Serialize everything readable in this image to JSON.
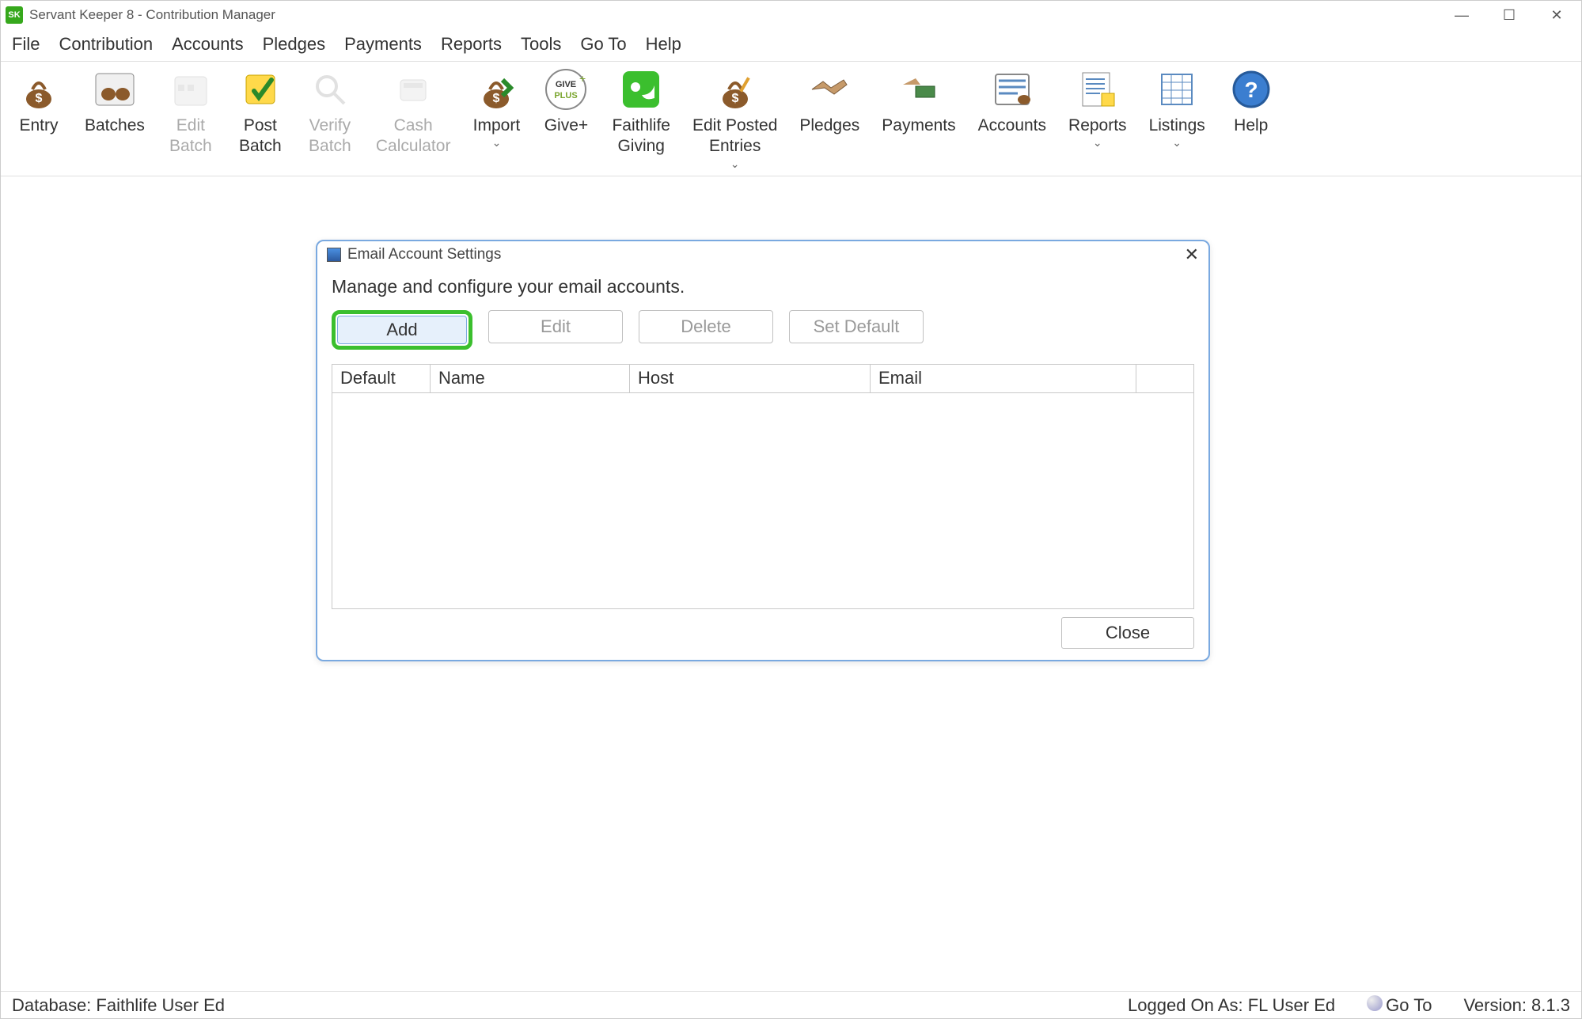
{
  "title": "Servant Keeper 8 - Contribution Manager",
  "menu": [
    "File",
    "Contribution",
    "Accounts",
    "Pledges",
    "Payments",
    "Reports",
    "Tools",
    "Go To",
    "Help"
  ],
  "toolbar": [
    {
      "label": "Entry",
      "icon": "bag",
      "disabled": false,
      "drop": false
    },
    {
      "label": "Batches",
      "icon": "batches",
      "disabled": false,
      "drop": false
    },
    {
      "label": "Edit\nBatch",
      "icon": "calendar",
      "disabled": true,
      "drop": false
    },
    {
      "label": "Post\nBatch",
      "icon": "post",
      "disabled": false,
      "drop": false
    },
    {
      "label": "Verify\nBatch",
      "icon": "verify",
      "disabled": true,
      "drop": false
    },
    {
      "label": "Cash\nCalculator",
      "icon": "calc",
      "disabled": true,
      "drop": false
    },
    {
      "label": "Import",
      "icon": "import",
      "disabled": false,
      "drop": true
    },
    {
      "label": "Give+",
      "icon": "giveplus",
      "disabled": false,
      "drop": false
    },
    {
      "label": "Faithlife\nGiving",
      "icon": "faithlife",
      "disabled": false,
      "drop": false
    },
    {
      "label": "Edit Posted\nEntries",
      "icon": "editposted",
      "disabled": false,
      "drop": true
    },
    {
      "label": "Pledges",
      "icon": "pledges",
      "disabled": false,
      "drop": false
    },
    {
      "label": "Payments",
      "icon": "payments",
      "disabled": false,
      "drop": false
    },
    {
      "label": "Accounts",
      "icon": "accounts",
      "disabled": false,
      "drop": false
    },
    {
      "label": "Reports",
      "icon": "reports",
      "disabled": false,
      "drop": true
    },
    {
      "label": "Listings",
      "icon": "listings",
      "disabled": false,
      "drop": true
    },
    {
      "label": "Help",
      "icon": "help",
      "disabled": false,
      "drop": false
    }
  ],
  "dialog": {
    "title": "Email Account Settings",
    "description": "Manage and configure your email accounts.",
    "buttons": {
      "add": "Add",
      "edit": "Edit",
      "delete": "Delete",
      "set_default": "Set Default"
    },
    "columns": [
      "Default",
      "Name",
      "Host",
      "Email"
    ],
    "close": "Close"
  },
  "status": {
    "database": "Database: Faithlife User Ed",
    "logged_on": "Logged On As: FL User Ed",
    "goto": "Go To",
    "version": "Version: 8.1.3"
  }
}
